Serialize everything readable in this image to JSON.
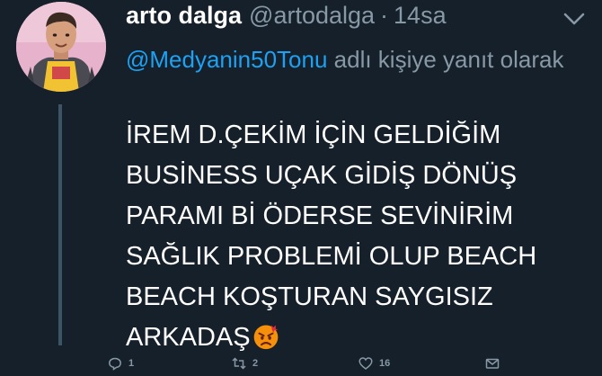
{
  "tweet": {
    "display_name": "arto dalga",
    "handle": "@artodalga",
    "separator": "·",
    "time": "14sa",
    "reply": {
      "mention": "@Medyanin50Tonu",
      "suffix": " adlı kişiye yanıt olarak"
    },
    "body": "İREM D.ÇEKİM İÇİN GELDİĞİM\nBUSİNESS UÇAK GİDİŞ DÖNÜŞ\nPARAMI Bİ ÖDERSE SEVİNİRİM\nSAĞLIK PROBLEMİ OLUP BEACH\nBEACH KOŞTURAN SAYGISIZ\nARKADAŞ",
    "emoji": "angry-face-emoji",
    "actions": {
      "reply_count": "1",
      "retweet_count": "2",
      "like_count": "16"
    }
  },
  "icons": {
    "menu": "chevron-down-icon",
    "reply": "reply-icon",
    "retweet": "retweet-icon",
    "like": "heart-icon",
    "dm": "message-icon"
  },
  "colors": {
    "background": "#15202b",
    "text": "#ffffff",
    "secondary": "#8899a6",
    "link": "#1da1f2"
  }
}
